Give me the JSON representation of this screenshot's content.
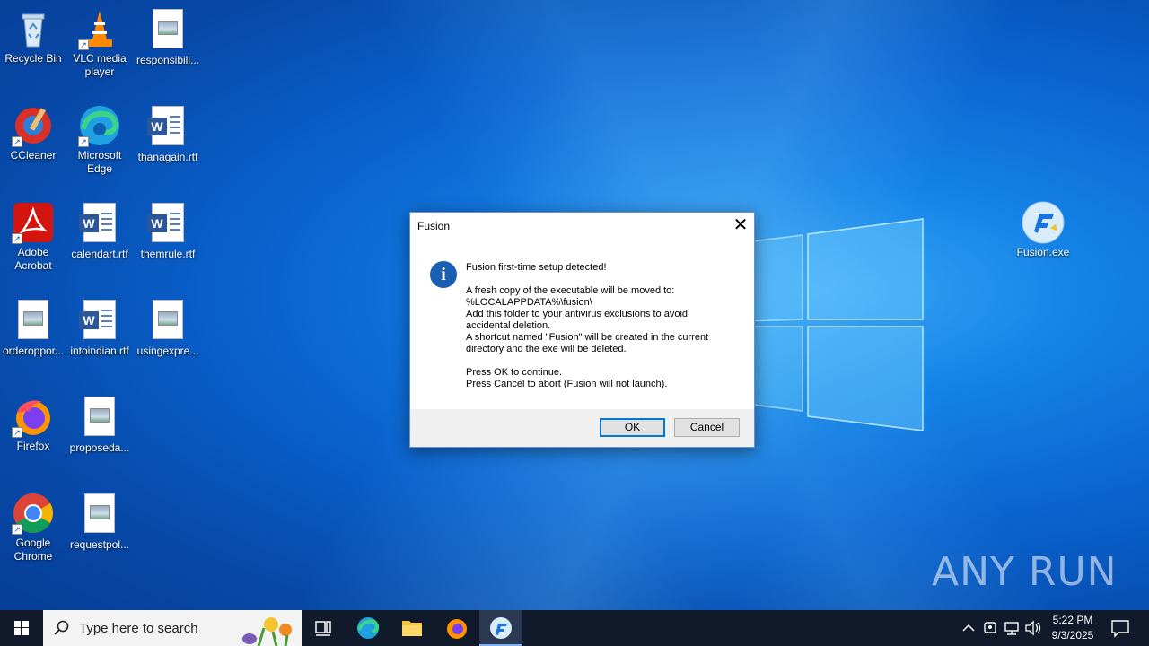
{
  "desktop": {
    "icons": [
      {
        "label": "Recycle Bin",
        "icon": "recycle-bin-icon"
      },
      {
        "label": "VLC media player",
        "icon": "vlc-icon"
      },
      {
        "label": "responsibili...",
        "icon": "image-file-icon"
      },
      {
        "label": "CCleaner",
        "icon": "ccleaner-icon"
      },
      {
        "label": "Microsoft Edge",
        "icon": "edge-icon"
      },
      {
        "label": "thanagain.rtf",
        "icon": "word-file-icon"
      },
      {
        "label": "Adobe Acrobat",
        "icon": "acrobat-icon"
      },
      {
        "label": "calendart.rtf",
        "icon": "word-file-icon"
      },
      {
        "label": "themrule.rtf",
        "icon": "word-file-icon"
      },
      {
        "label": "orderoppor...",
        "icon": "image-file-icon"
      },
      {
        "label": "intoindian.rtf",
        "icon": "word-file-icon"
      },
      {
        "label": "usingexpre...",
        "icon": "image-file-icon"
      },
      {
        "label": "Firefox",
        "icon": "firefox-icon"
      },
      {
        "label": "proposeda...",
        "icon": "image-file-icon"
      },
      {
        "label": "Google Chrome",
        "icon": "chrome-icon"
      },
      {
        "label": "requestpol...",
        "icon": "image-file-icon"
      },
      {
        "label": "Fusion.exe",
        "icon": "fusion-icon"
      }
    ]
  },
  "dialog": {
    "title": "Fusion",
    "close_glyph": "✕",
    "icon_glyph": "i",
    "lines": [
      "Fusion first-time setup detected!",
      "",
      "A fresh copy of the executable will be moved to:",
      "%LOCALAPPDATA%\\fusion\\",
      "Add this folder to your antivirus exclusions to avoid",
      "accidental deletion.",
      "A shortcut named \"Fusion\" will be created in the current",
      "directory and the exe will be deleted.",
      "",
      "Press OK to continue.",
      "Press Cancel to abort (Fusion will not launch)."
    ],
    "ok_label": "OK",
    "cancel_label": "Cancel"
  },
  "watermark": "ANY RUN",
  "taskbar": {
    "search_placeholder": "Type here to search",
    "time": "5:22 PM",
    "date": "9/3/2025"
  },
  "colors": {
    "dialog_accent": "#0078d7",
    "taskbar_bg": "#101a2b",
    "info_icon": "#1a5fb4"
  }
}
